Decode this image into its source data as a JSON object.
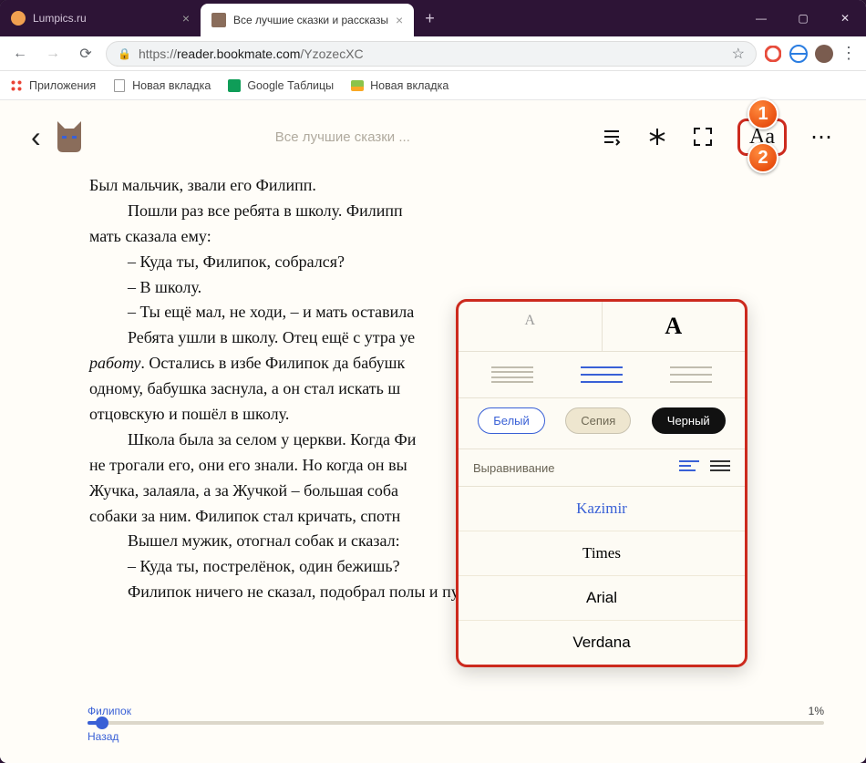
{
  "tabs": {
    "inactive": {
      "title": "Lumpics.ru"
    },
    "active": {
      "title": "Все лучшие сказки и рассказы"
    }
  },
  "url": {
    "scheme": "https://",
    "host": "reader.bookmate.com",
    "path": "/YzozecXC"
  },
  "bookmarks": {
    "apps": "Приложения",
    "b1": "Новая вкладка",
    "b2": "Google Таблицы",
    "b3": "Новая вкладка"
  },
  "reader": {
    "title_short": "Все лучшие сказки ...",
    "aa": "Aa",
    "p1": "Был мальчик, звали его Филипп.",
    "p2a": "Пошли раз все ребята в школу. Филипп ",
    "p2b": "мать сказала ему:",
    "p3": "– Куда ты, Филипок, собрался?",
    "p4": "– В школу.",
    "p5": "– Ты ещё мал, не ходи, – и мать оставила",
    "p6a": "Ребята ушли в школу. Отец ещё с утра уе",
    "p6b": "работу",
    "p6c": ". Остались в избе Филипок да бабушк",
    "p6d": "одному, бабушка заснула, а он стал искать ш",
    "p6e": "отцовскую и пошёл в школу.",
    "p7a": "Школа была за селом у церкви. Когда Фи",
    "p7b": "не трогали его, они его знали. Но когда он вы",
    "p7c": "Жучка, залаяла, а за Жучкой – большая соба",
    "p7d_full": "собаки за ним. Филипок стал кричать, спотн                                                                      ть,",
    "p8": "Вышел мужик, отогнал собак и сказал:",
    "p9": "– Куда ты, пострелёнок, один бежишь?",
    "p10": "Филипок ничего не сказал, подобрал полы и пустился бежать во весь дух."
  },
  "progress": {
    "chapter": "Филипок",
    "percent": "1%",
    "back": "Назад"
  },
  "popup": {
    "size_small": "A",
    "size_big": "A",
    "theme_white": "Белый",
    "theme_sepia": "Сепия",
    "theme_black": "Черный",
    "align_label": "Выравнивание",
    "fonts": {
      "kazimir": "Kazimir",
      "times": "Times",
      "arial": "Arial",
      "verdana": "Verdana"
    }
  },
  "badges": {
    "one": "1",
    "two": "2"
  }
}
